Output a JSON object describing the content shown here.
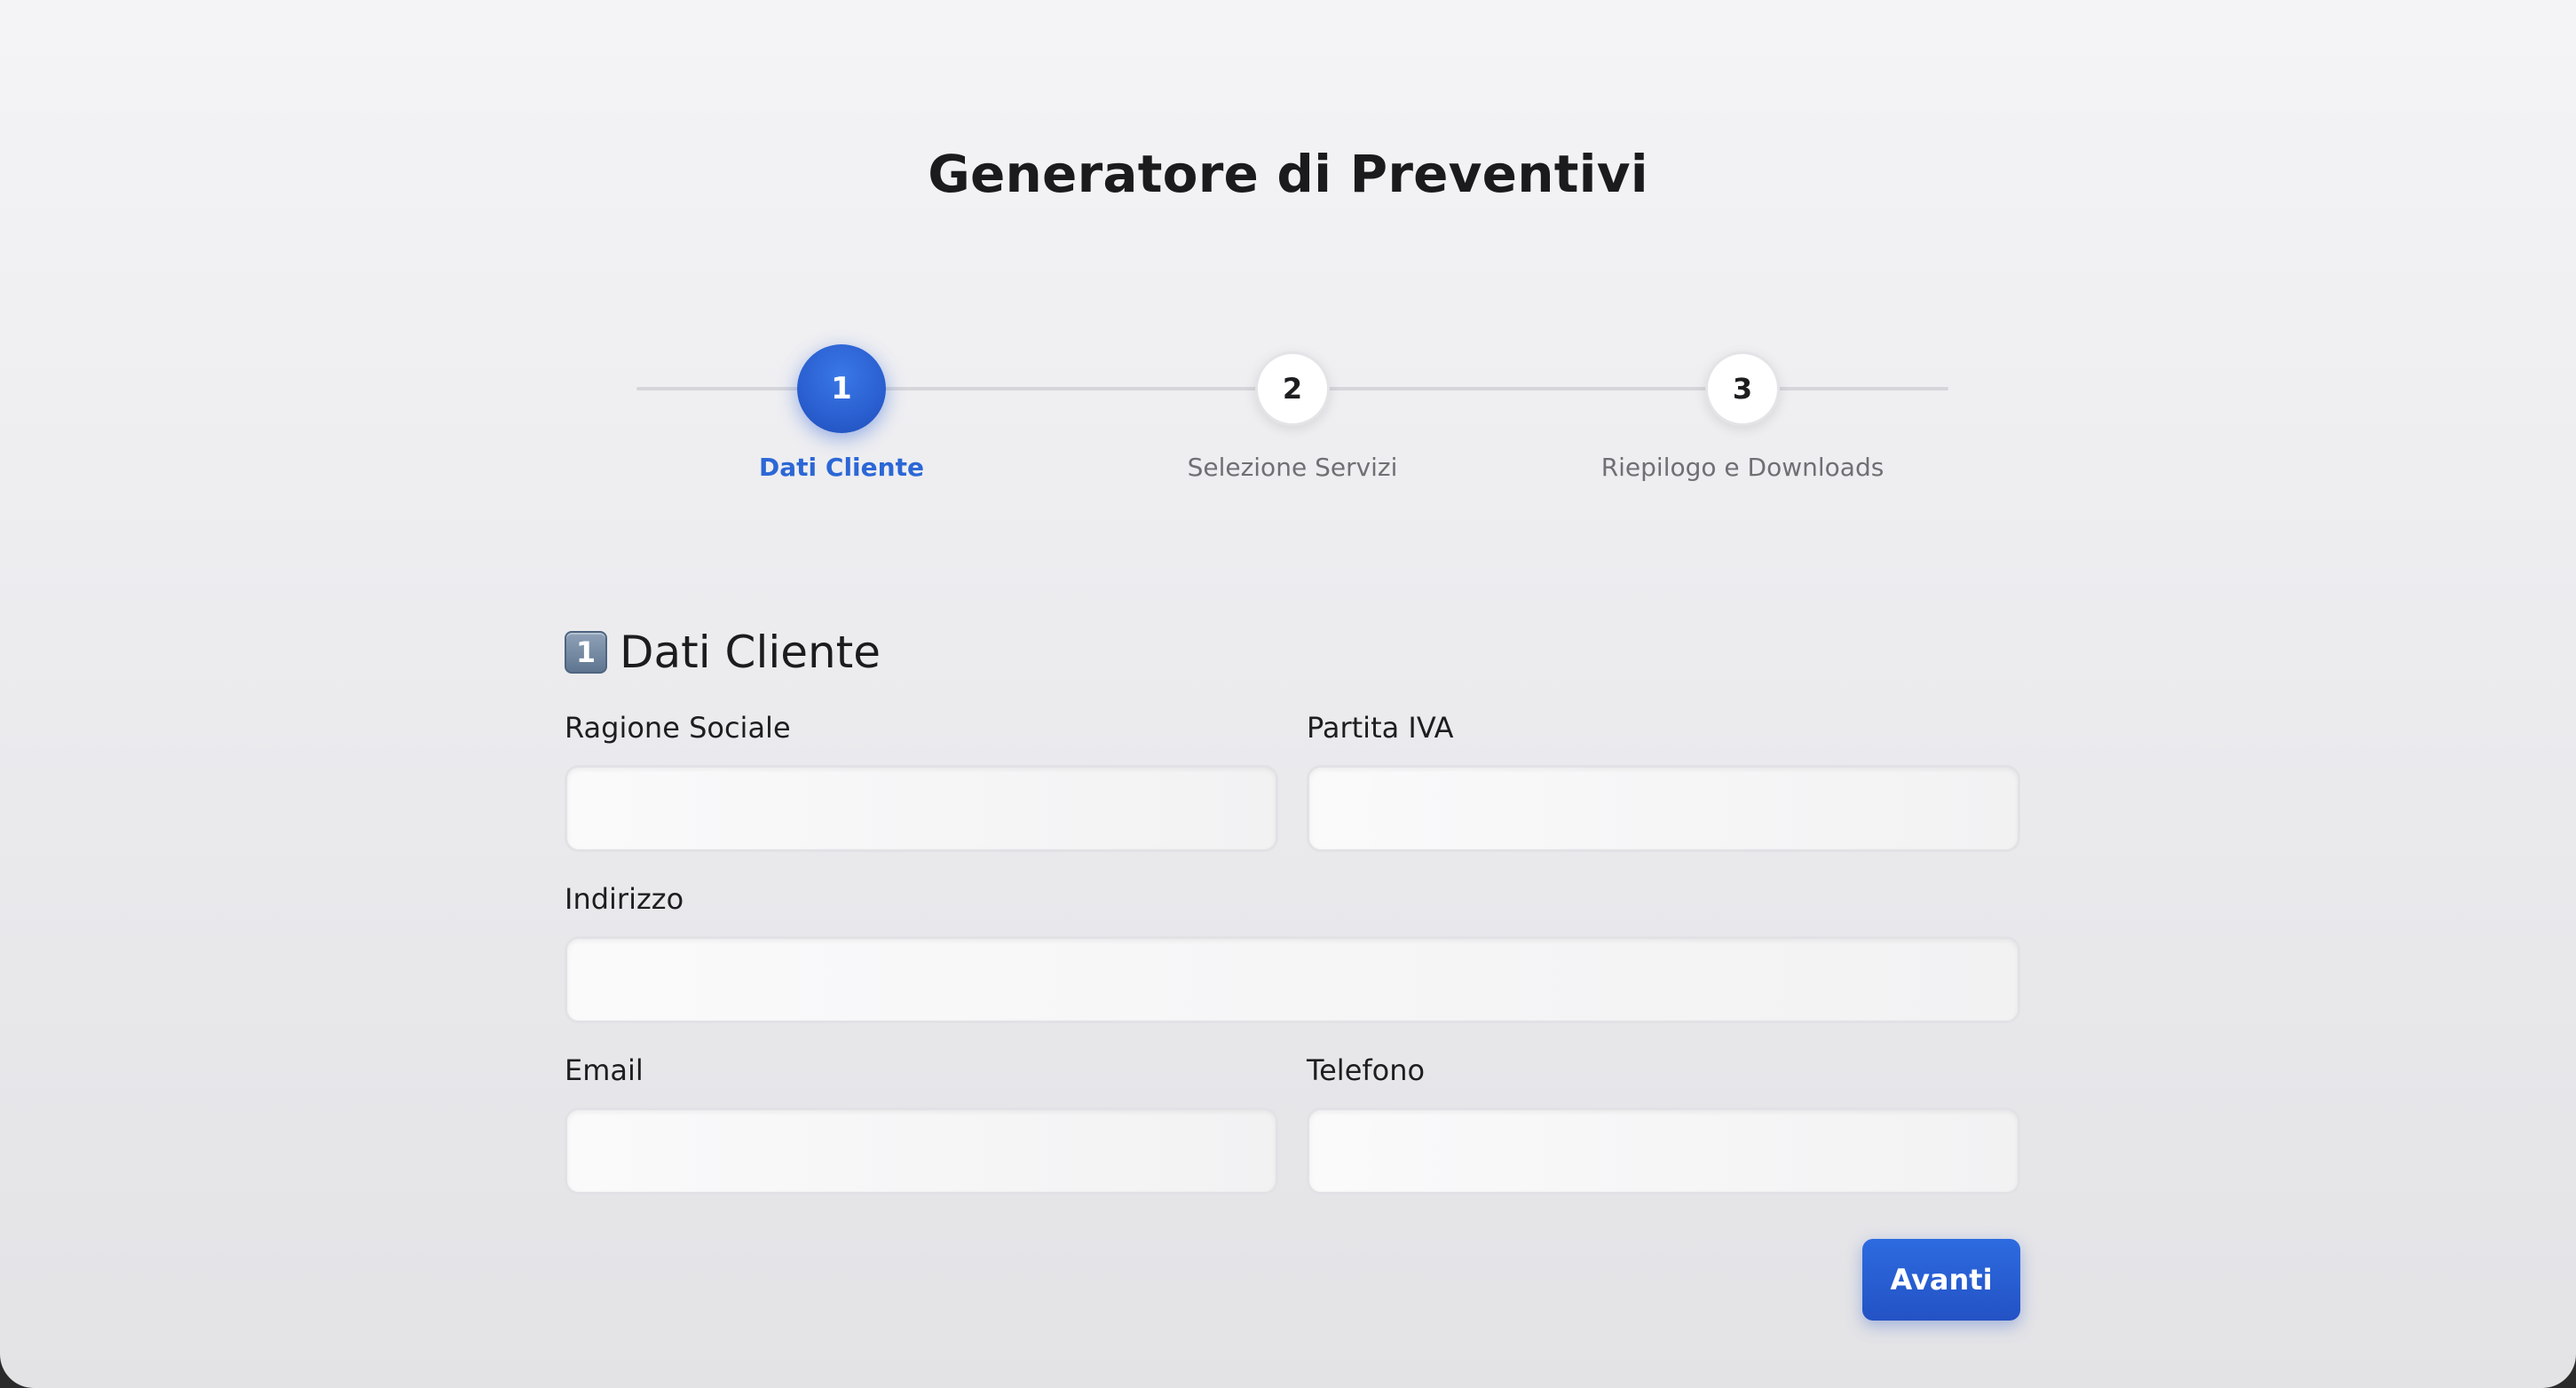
{
  "page": {
    "title": "Generatore di Preventivi"
  },
  "stepper": {
    "steps": [
      {
        "number": "1",
        "label": "Dati Cliente",
        "active": true
      },
      {
        "number": "2",
        "label": "Selezione Servizi",
        "active": false
      },
      {
        "number": "3",
        "label": "Riepilogo e Downloads",
        "active": false
      }
    ],
    "accent_color": "#2c67d6"
  },
  "form": {
    "section_icon": "1",
    "section_title": "Dati Cliente",
    "fields": {
      "ragione_sociale": {
        "label": "Ragione Sociale",
        "value": "",
        "placeholder": ""
      },
      "partita_iva": {
        "label": "Partita IVA",
        "value": "",
        "placeholder": ""
      },
      "indirizzo": {
        "label": "Indirizzo",
        "value": "",
        "placeholder": ""
      },
      "email": {
        "label": "Email",
        "value": "",
        "placeholder": ""
      },
      "telefono": {
        "label": "Telefono",
        "value": "",
        "placeholder": ""
      }
    },
    "next_button_label": "Avanti",
    "button_color": "#2a5fd0"
  }
}
